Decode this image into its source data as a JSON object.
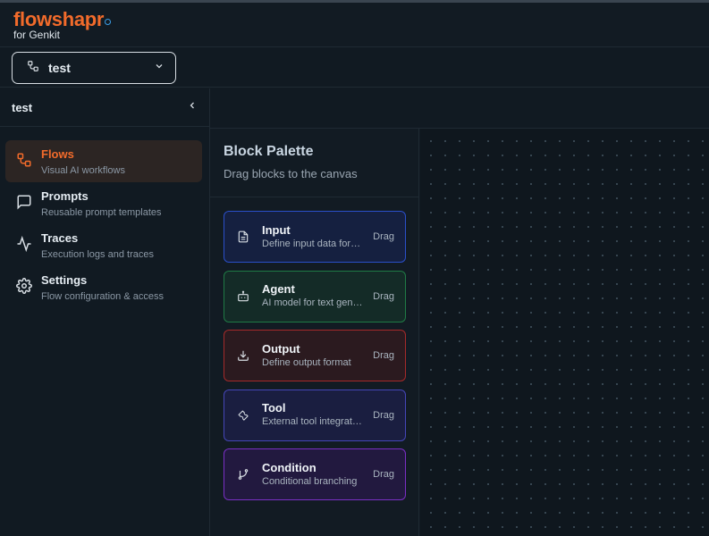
{
  "app": {
    "logo": "flowshapr",
    "logo_sub": "for Genkit",
    "accent": "#f26b2b"
  },
  "flow_selector": {
    "selected": "test"
  },
  "sidebar": {
    "title": "test",
    "items": [
      {
        "label": "Flows",
        "desc": "Visual AI workflows",
        "icon": "flow-icon",
        "active": true
      },
      {
        "label": "Prompts",
        "desc": "Reusable prompt templates",
        "icon": "message-icon"
      },
      {
        "label": "Traces",
        "desc": "Execution logs and traces",
        "icon": "activity-icon"
      },
      {
        "label": "Settings",
        "desc": "Flow configuration & access",
        "icon": "gear-icon"
      }
    ]
  },
  "palette": {
    "title": "Block Palette",
    "subtitle": "Drag blocks to the canvas",
    "drag_label": "Drag",
    "blocks": [
      {
        "name": "Input",
        "desc": "Define input data format",
        "icon": "file-icon",
        "color": "#2a4fc9"
      },
      {
        "name": "Agent",
        "desc": "AI model for text generation",
        "icon": "bot-icon",
        "color": "#1f7a45"
      },
      {
        "name": "Output",
        "desc": "Define output format",
        "icon": "download-icon",
        "color": "#a52a2a"
      },
      {
        "name": "Tool",
        "desc": "External tool integration",
        "icon": "wrench-icon",
        "color": "#4546b8"
      },
      {
        "name": "Condition",
        "desc": "Conditional branching",
        "icon": "branch-icon",
        "color": "#7a2fc4"
      }
    ]
  }
}
